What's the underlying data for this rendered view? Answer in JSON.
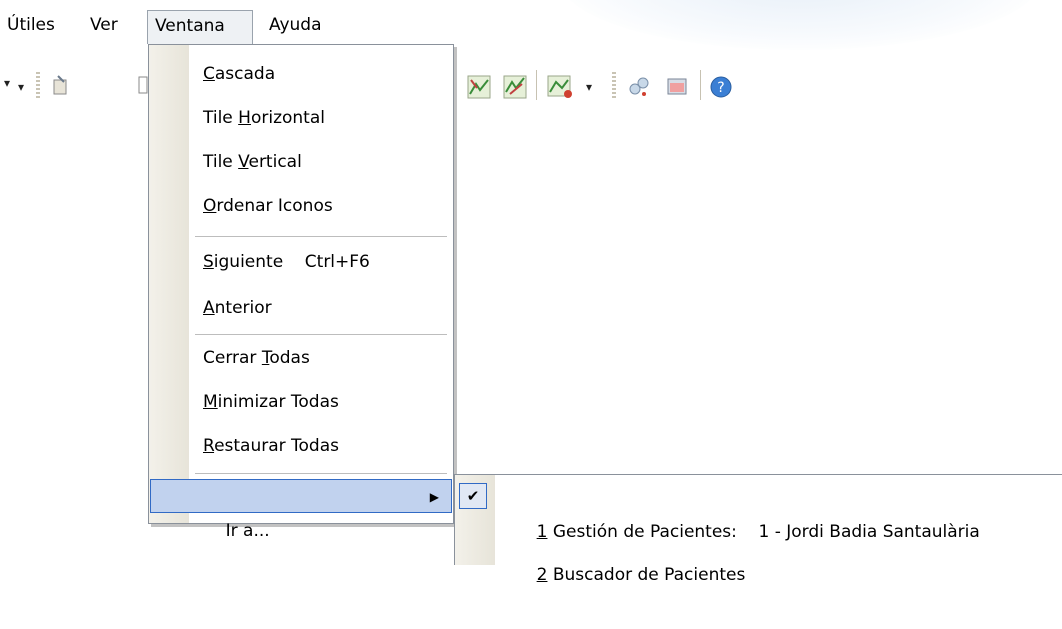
{
  "menubar": {
    "items": [
      {
        "label": "Útiles"
      },
      {
        "label": "Ver"
      },
      {
        "label": "Ventana"
      },
      {
        "label": "Ayuda"
      }
    ]
  },
  "window_menu": {
    "items": [
      {
        "pre": "",
        "key": "C",
        "post": "ascada"
      },
      {
        "pre": "Tile ",
        "key": "H",
        "post": "orizontal"
      },
      {
        "pre": "Tile ",
        "key": "V",
        "post": "ertical"
      },
      {
        "pre": "",
        "key": "O",
        "post": "rdenar Iconos"
      },
      {
        "pre": "",
        "key": "S",
        "post": "iguiente    Ctrl+F6"
      },
      {
        "pre": "",
        "key": "A",
        "post": "nterior"
      },
      {
        "pre": "Cerrar ",
        "key": "T",
        "post": "odas"
      },
      {
        "pre": "",
        "key": "M",
        "post": "inimizar Todas"
      },
      {
        "pre": "",
        "key": "R",
        "post": "estaurar Todas"
      },
      {
        "pre": "Ir a...",
        "key": "",
        "post": ""
      }
    ],
    "submenu_arrow": "▶"
  },
  "goto_submenu": {
    "items": [
      {
        "key": "1",
        "text": " Gestión de Pacientes:    1 - Jordi Badia Santaulària",
        "checked": true
      },
      {
        "key": "2",
        "text": " Buscador de Pacientes",
        "checked": false
      }
    ],
    "check_glyph": "✔"
  },
  "toolbar": {
    "dropdown_glyph": "▾"
  },
  "colors": {
    "highlight_bg": "#c1d2ee",
    "highlight_border": "#316ac5",
    "menu_border": "#8a919b"
  }
}
